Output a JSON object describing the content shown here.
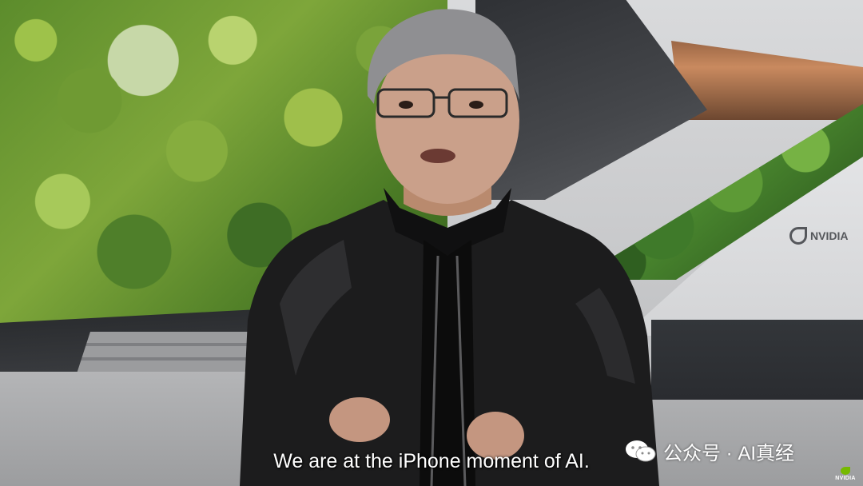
{
  "video": {
    "subtitle": "We are at the iPhone moment of AI.",
    "wall_logo_text": "NVIDIA"
  },
  "watermark": {
    "icon": "wechat-icon",
    "text": "公众号 · AI真经"
  },
  "corner_logo": {
    "text": "NVIDIA",
    "color": "#76b900"
  }
}
